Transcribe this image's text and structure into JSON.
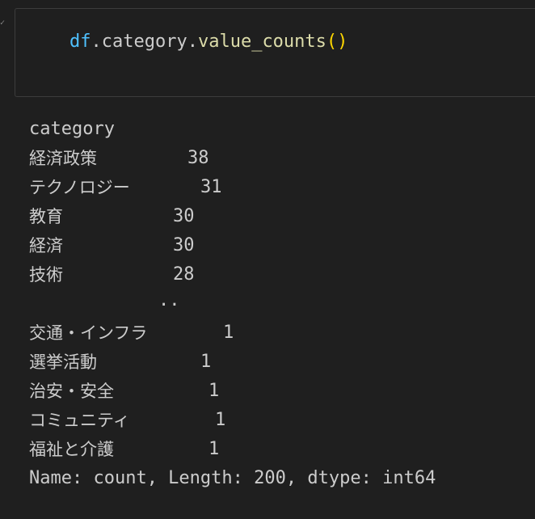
{
  "cell": {
    "code": {
      "var": "df",
      "dot1": ".",
      "prop": "category",
      "dot2": ".",
      "func": "value_counts",
      "parens": "()"
    }
  },
  "output": {
    "header": "category",
    "top_rows": [
      {
        "label": "経済政策",
        "value": "38"
      },
      {
        "label": "テクノロジー",
        "value": "31"
      },
      {
        "label": "教育",
        "value": "30"
      },
      {
        "label": "経済",
        "value": "30"
      },
      {
        "label": "技術",
        "value": "28"
      }
    ],
    "ellipsis": "..",
    "bottom_rows": [
      {
        "label": "交通・インフラ",
        "value": "1"
      },
      {
        "label": "選挙活動",
        "value": "1"
      },
      {
        "label": "治安・安全",
        "value": "1"
      },
      {
        "label": "コミュニティ",
        "value": "1"
      },
      {
        "label": "福祉と介護",
        "value": "1"
      }
    ],
    "footer": "Name: count, Length: 200, dtype: int64"
  }
}
